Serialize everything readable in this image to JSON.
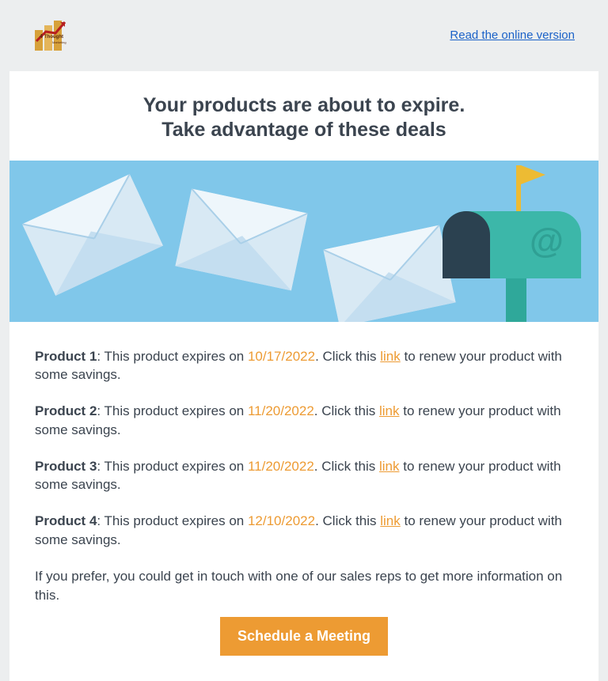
{
  "topbar": {
    "logo_alt": "4Thought Marketing",
    "online_link": "Read the online version"
  },
  "heading": {
    "line1": "Your products are about to expire.",
    "line2": "Take advantage of these deals"
  },
  "products": [
    {
      "name": "Product 1",
      "pre": ": This product expires on ",
      "date": "10/17/2022",
      "mid": ". Click this ",
      "link": "link",
      "post": " to renew your product with some savings."
    },
    {
      "name": "Product 2",
      "pre": ": This product expires on ",
      "date": "11/20/2022",
      "mid": ". Click this ",
      "link": "link",
      "post": " to renew your product with some savings."
    },
    {
      "name": "Product 3",
      "pre": ": This product expires on ",
      "date": "11/20/2022",
      "mid": ". Click this ",
      "link": "link",
      "post": " to renew your product with some savings."
    },
    {
      "name": "Product 4",
      "pre": ": This product expires on ",
      "date": "12/10/2022",
      "mid": ". Click this ",
      "link": "link",
      "post": " to renew your product with some savings."
    }
  ],
  "note": "If you prefer, you could get in touch with one of our sales reps to get more information on this.",
  "cta": "Schedule a Meeting"
}
